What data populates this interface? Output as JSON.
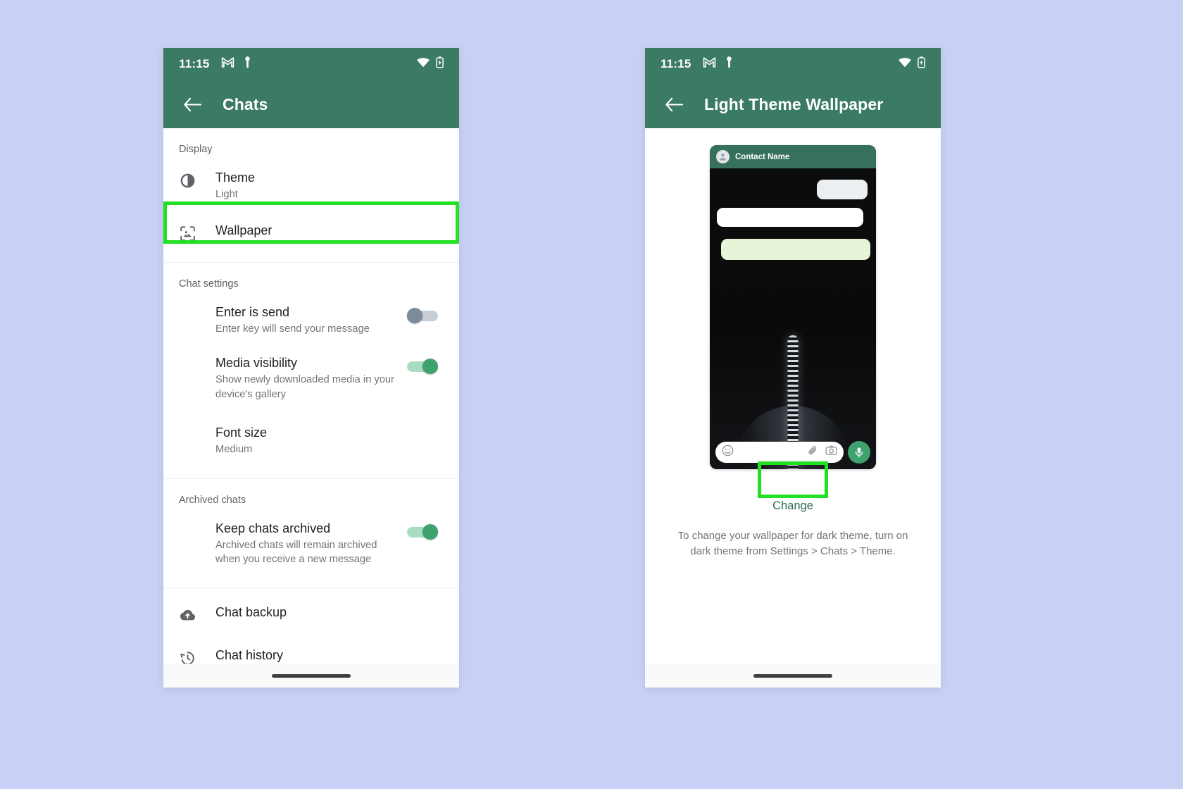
{
  "theme_colors": {
    "app_bar_green": "#3b7a63",
    "accent_green": "#3fa16e",
    "highlight_green": "#22e024",
    "page_background": "#c8d0f5"
  },
  "left_phone": {
    "status_bar": {
      "time": "11:15",
      "icons": [
        "gmail-icon",
        "vpn-key-icon",
        "wifi-icon",
        "battery-icon"
      ]
    },
    "app_bar": {
      "back_icon": "back-arrow-icon",
      "title": "Chats"
    },
    "sections": [
      {
        "header": "Display",
        "rows": [
          {
            "icon": "brightness-icon",
            "title": "Theme",
            "subtitle": "Light",
            "control": "none"
          },
          {
            "icon": "wallpaper-icon",
            "title": "Wallpaper",
            "subtitle": "",
            "control": "none",
            "highlighted": true
          }
        ]
      },
      {
        "header": "Chat settings",
        "rows": [
          {
            "icon": "",
            "title": "Enter is send",
            "subtitle": "Enter key will send your message",
            "control": "toggle",
            "toggle_on": false
          },
          {
            "icon": "",
            "title": "Media visibility",
            "subtitle": "Show newly downloaded media in your device's gallery",
            "control": "toggle",
            "toggle_on": true
          },
          {
            "icon": "",
            "title": "Font size",
            "subtitle": "Medium",
            "control": "none"
          }
        ]
      },
      {
        "header": "Archived chats",
        "rows": [
          {
            "icon": "",
            "title": "Keep chats archived",
            "subtitle": "Archived chats will remain archived when you receive a new message",
            "control": "toggle",
            "toggle_on": true
          }
        ]
      },
      {
        "header": "",
        "rows": [
          {
            "icon": "cloud-upload-icon",
            "title": "Chat backup",
            "subtitle": "",
            "control": "none"
          },
          {
            "icon": "history-icon",
            "title": "Chat history",
            "subtitle": "",
            "control": "none"
          }
        ]
      }
    ]
  },
  "right_phone": {
    "status_bar": {
      "time": "11:15",
      "icons": [
        "gmail-icon",
        "vpn-key-icon",
        "wifi-icon",
        "battery-icon"
      ]
    },
    "app_bar": {
      "back_icon": "back-arrow-icon",
      "title": "Light Theme Wallpaper"
    },
    "preview": {
      "contact_name": "Contact Name",
      "input_icons": [
        "emoji-icon",
        "attach-icon",
        "camera-icon",
        "mic-icon"
      ]
    },
    "change_button": "Change",
    "description": "To change your wallpaper for dark theme, turn on dark theme from Settings > Chats > Theme."
  }
}
